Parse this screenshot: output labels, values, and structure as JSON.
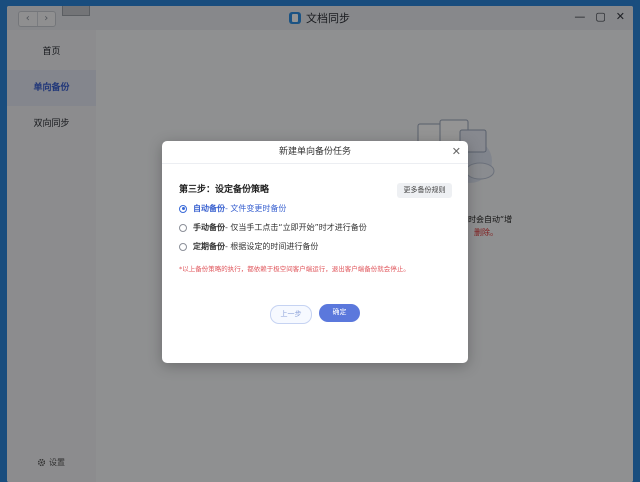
{
  "window": {
    "title": "文档同步",
    "nav": {
      "back": "‹",
      "forward": "›"
    },
    "controls": {
      "close": "✕",
      "maximize": "▢",
      "minimize": "—"
    }
  },
  "sidebar": {
    "items": [
      {
        "label": "首页",
        "active": false
      },
      {
        "label": "单向备份",
        "active": true
      },
      {
        "label": "双向同步",
        "active": false
      }
    ],
    "settings_label": "设置"
  },
  "background": {
    "line1": "改动时会自动“增",
    "line2": "删除。"
  },
  "dialog": {
    "title": "新建单向备份任务",
    "step": "第三步：设定备份策略",
    "more_rules": "更多备份规则",
    "options": [
      {
        "name": "自动备份",
        "desc": " - 文件变更时备份",
        "checked": true
      },
      {
        "name": "手动备份",
        "desc": " - 仅当手工点击“立即开始”时才进行备份",
        "checked": false
      },
      {
        "name": "定期备份",
        "desc": " - 根据设定的时间进行备份",
        "checked": false
      }
    ],
    "note": "*以上备份策略的执行，都依赖于极空间客户端运行，退出客户端备份就会停止。",
    "prev_button": "上一步",
    "ok_button": "确定"
  },
  "colors": {
    "accent": "#5b78dc",
    "note": "#e0555b",
    "titlebar_icon": "#2f8fe3"
  }
}
